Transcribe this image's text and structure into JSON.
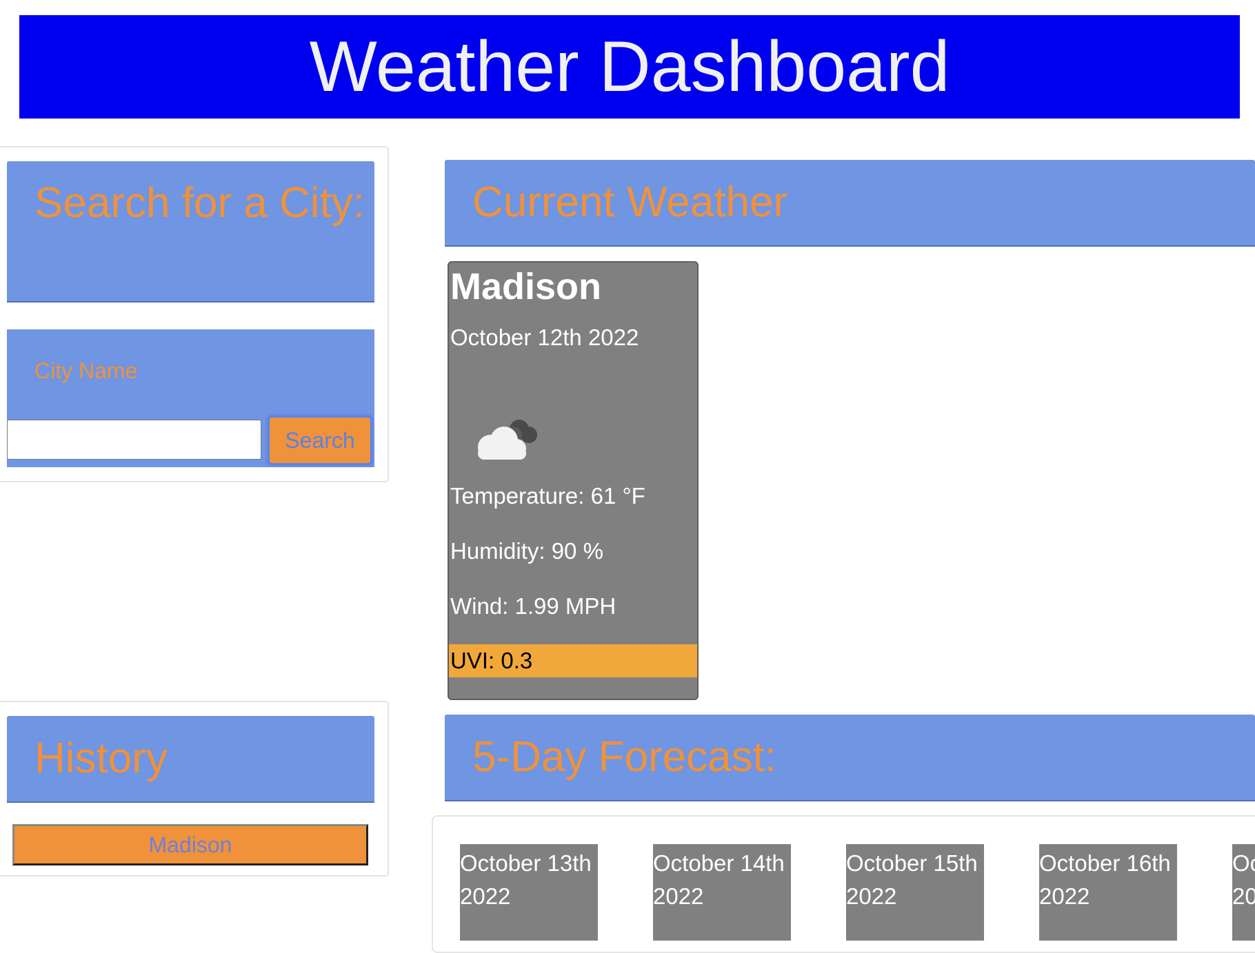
{
  "header": {
    "title": "Weather Dashboard"
  },
  "search": {
    "heading": "Search for a City:",
    "label": "City Name",
    "input_value": "",
    "button_label": "Search"
  },
  "history": {
    "heading": "History",
    "items": [
      "Madison"
    ]
  },
  "current": {
    "heading": "Current Weather",
    "city": "Madison",
    "date": "October 12th 2022",
    "icon": "cloud-icon",
    "temperature": "Temperature: 61 °F",
    "humidity": "Humidity: 90 %",
    "wind": "Wind: 1.99 MPH",
    "uvi": "UVI: 0.3"
  },
  "forecast": {
    "heading": "5-Day Forecast:",
    "days": [
      {
        "date_line1": "October 13th",
        "date_line2": "2022"
      },
      {
        "date_line1": "October 14th",
        "date_line2": "2022"
      },
      {
        "date_line1": "October 15th",
        "date_line2": "2022"
      },
      {
        "date_line1": "October 16th",
        "date_line2": "2022"
      },
      {
        "date_line1": "Oc",
        "date_line2": "20"
      }
    ]
  },
  "colors": {
    "header_bg": "#0000f0",
    "panel_bg": "#6f95e3",
    "accent_orange": "#f0923a",
    "card_gray": "#808080",
    "uvi_bg": "#f0a83a"
  }
}
